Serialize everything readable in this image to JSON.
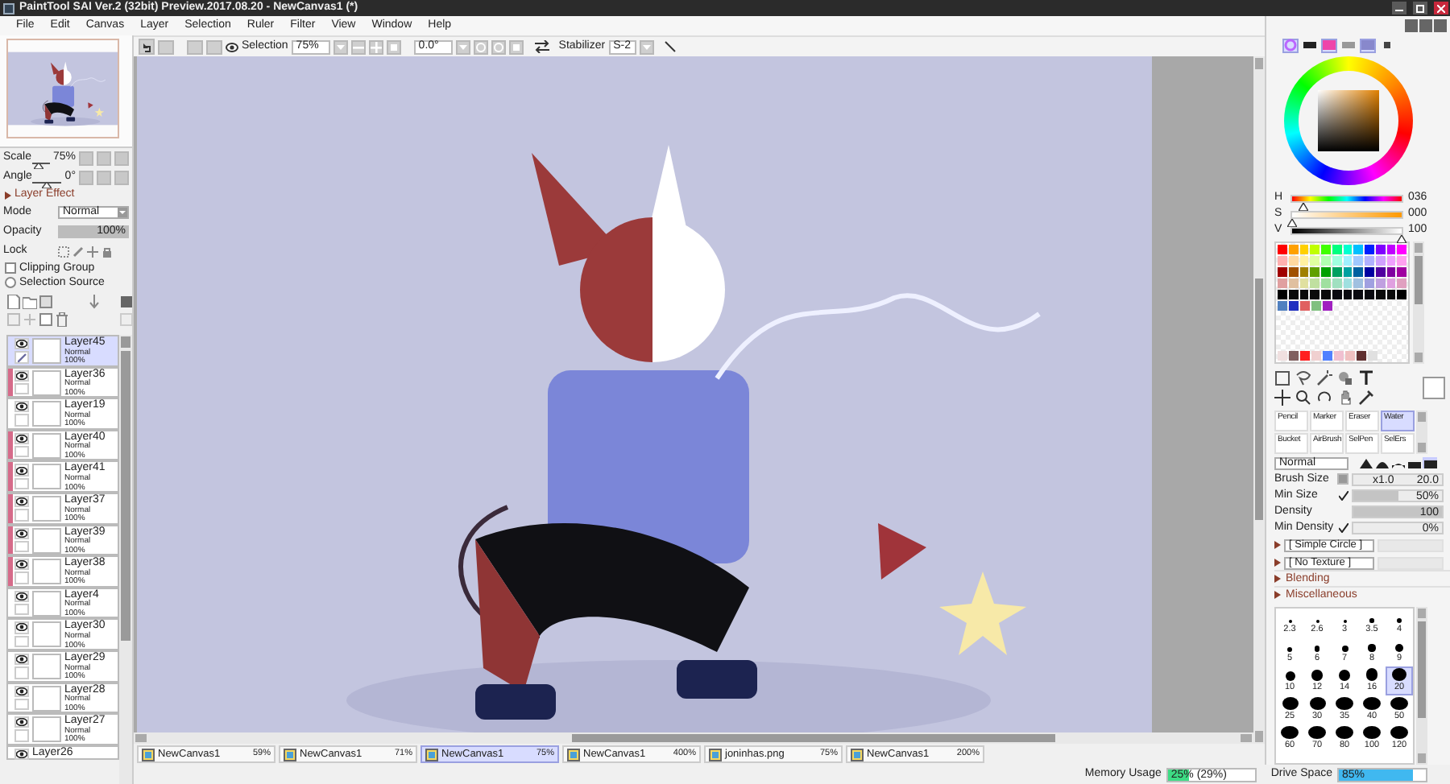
{
  "window": {
    "title": "PaintTool SAI Ver.2 (32bit) Preview.2017.08.20 - NewCanvas1 (*)"
  },
  "menu": [
    "File",
    "Edit",
    "Canvas",
    "Layer",
    "Selection",
    "Ruler",
    "Filter",
    "View",
    "Window",
    "Help"
  ],
  "toolbar": {
    "selection_label": "Selection",
    "zoom": "75%",
    "angle": "0.0°",
    "stabilizer_label": "Stabilizer",
    "stabilizer": "S-2"
  },
  "navigator": {
    "scale_label": "Scale",
    "scale": "75%",
    "scale_level": {
      "level": 0.35
    },
    "angle_label": "Angle",
    "angle": "0°",
    "angle_level": {
      "level": 0.5
    }
  },
  "layer_effect": {
    "label": "Layer Effect",
    "expanded": false
  },
  "layer_props": {
    "mode_label": "Mode",
    "mode": "Normal",
    "opacity": {
      "label": "Opacity",
      "reading": "100%",
      "level": 1
    },
    "lock_label": "Lock",
    "clipping_group": {
      "label": "Clipping Group",
      "checked": false
    },
    "selection_source": {
      "label": "Selection Source",
      "checked": false
    }
  },
  "layers": [
    {
      "name": "Layer45",
      "mode": "Normal",
      "opacity": "100%",
      "selected": true,
      "clipped": false,
      "visible": true
    },
    {
      "name": "Layer36",
      "mode": "Normal",
      "opacity": "100%",
      "selected": false,
      "clipped": true,
      "visible": true
    },
    {
      "name": "Layer19",
      "mode": "Normal",
      "opacity": "100%",
      "selected": false,
      "clipped": false,
      "visible": true
    },
    {
      "name": "Layer40",
      "mode": "Normal",
      "opacity": "100%",
      "selected": false,
      "clipped": true,
      "visible": true
    },
    {
      "name": "Layer41",
      "mode": "Normal",
      "opacity": "100%",
      "selected": false,
      "clipped": true,
      "visible": true
    },
    {
      "name": "Layer37",
      "mode": "Normal",
      "opacity": "100%",
      "selected": false,
      "clipped": true,
      "visible": true
    },
    {
      "name": "Layer39",
      "mode": "Normal",
      "opacity": "100%",
      "selected": false,
      "clipped": true,
      "visible": true
    },
    {
      "name": "Layer38",
      "mode": "Normal",
      "opacity": "100%",
      "selected": false,
      "clipped": true,
      "visible": true
    },
    {
      "name": "Layer4",
      "mode": "Normal",
      "opacity": "100%",
      "selected": false,
      "clipped": false,
      "visible": true
    },
    {
      "name": "Layer30",
      "mode": "Normal",
      "opacity": "100%",
      "selected": false,
      "clipped": false,
      "visible": true
    },
    {
      "name": "Layer29",
      "mode": "Normal",
      "opacity": "100%",
      "selected": false,
      "clipped": false,
      "visible": true
    },
    {
      "name": "Layer28",
      "mode": "Normal",
      "opacity": "100%",
      "selected": false,
      "clipped": false,
      "visible": true
    },
    {
      "name": "Layer27",
      "mode": "Normal",
      "opacity": "100%",
      "selected": false,
      "clipped": false,
      "visible": true
    },
    {
      "name": "Layer26",
      "selected": false,
      "clipped": false,
      "visible": true
    }
  ],
  "color": {
    "panels": [
      {
        "on": true
      },
      {
        "on": false
      },
      {
        "on": true
      },
      {
        "on": false
      },
      {
        "on": true
      },
      {
        "on": false
      }
    ],
    "h": {
      "label": "H",
      "reading": "036",
      "level": 0.1
    },
    "s": {
      "label": "S",
      "reading": "000",
      "level": 0
    },
    "v": {
      "label": "V",
      "reading": "100",
      "level": 1
    }
  },
  "swatch_rows": [
    [
      {
        "color": "#ff0000"
      },
      {
        "color": "#ffa000"
      },
      {
        "color": "#ffd000"
      },
      {
        "color": "#c0ff00"
      },
      {
        "color": "#40ff00"
      },
      {
        "color": "#00ff80"
      },
      {
        "color": "#00ffd0"
      },
      {
        "color": "#00c0ff"
      },
      {
        "color": "#0020ff"
      },
      {
        "color": "#8000ff"
      },
      {
        "color": "#c000ff"
      },
      {
        "color": "#ff00ff"
      }
    ],
    [
      {
        "color": "#ffb0b0"
      },
      {
        "color": "#ffd8a0"
      },
      {
        "color": "#fff0a0"
      },
      {
        "color": "#e0ffa0"
      },
      {
        "color": "#b0ffb0"
      },
      {
        "color": "#a0ffe0"
      },
      {
        "color": "#a0f0ff"
      },
      {
        "color": "#a0c8ff"
      },
      {
        "color": "#b0b0ff"
      },
      {
        "color": "#d0a0ff"
      },
      {
        "color": "#f0a0ff"
      },
      {
        "color": "#ffa0f0"
      }
    ],
    [
      {
        "color": "#a00000"
      },
      {
        "color": "#a05000"
      },
      {
        "color": "#a08000"
      },
      {
        "color": "#60a000"
      },
      {
        "color": "#00a000"
      },
      {
        "color": "#00a060"
      },
      {
        "color": "#00a0a0"
      },
      {
        "color": "#0060a0"
      },
      {
        "color": "#0000a0"
      },
      {
        "color": "#5000a0"
      },
      {
        "color": "#8000a0"
      },
      {
        "color": "#a000a0"
      }
    ],
    [
      {
        "color": "#e0a0a0"
      },
      {
        "color": "#e0c0a0"
      },
      {
        "color": "#e0e0a0"
      },
      {
        "color": "#c0e0a0"
      },
      {
        "color": "#a0e0a0"
      },
      {
        "color": "#a0e0c0"
      },
      {
        "color": "#a0e0e0"
      },
      {
        "color": "#a0c0e0"
      },
      {
        "color": "#a0a0e0"
      },
      {
        "color": "#c0a0e0"
      },
      {
        "color": "#e0a0e0"
      },
      {
        "color": "#e0a0c0"
      }
    ],
    [
      {
        "color": "#000000"
      },
      {
        "color": "#0a0a0a"
      },
      {
        "color": "#0a0a0a"
      },
      {
        "color": "#0a0a0a"
      },
      {
        "color": "#0a0a0a"
      },
      {
        "color": "#0a0a10"
      },
      {
        "color": "#0a0a10"
      },
      {
        "color": "#0a0a10"
      },
      {
        "color": "#0a0a10"
      },
      {
        "color": "#0a0a0a"
      },
      {
        "color": "#0a0a0a"
      },
      {
        "color": "#000000"
      }
    ],
    [
      {
        "color": "#5080c0"
      },
      {
        "color": "#2030c0"
      },
      {
        "color": "#e06060"
      },
      {
        "color": "#80c080"
      },
      {
        "color": "#a020c0"
      }
    ],
    [
      {
        "color": "#f0e0e0"
      },
      {
        "color": "#806060"
      },
      {
        "color": "#ff2020"
      },
      {
        "color": "#f0d0d0"
      },
      {
        "color": "#5080ff"
      },
      {
        "color": "#f0c0d0"
      },
      {
        "color": "#f0c0c0"
      },
      {
        "color": "#603030"
      },
      {
        "color": "#e0e0e0"
      }
    ]
  ],
  "current_color": {
    "color": "#ffffff"
  },
  "brushes": [
    {
      "name": "Pencil",
      "selected": false
    },
    {
      "name": "Marker",
      "selected": false
    },
    {
      "name": "Eraser",
      "selected": false
    },
    {
      "name": "Water",
      "selected": true
    },
    {
      "name": "Bucket",
      "selected": false
    },
    {
      "name": "AirBrush",
      "selected": false
    },
    {
      "name": "SelPen",
      "selected": false
    },
    {
      "name": "SelErs",
      "selected": false
    }
  ],
  "brush_mode": "Normal",
  "brush_shapes": [
    {
      "selected": false
    },
    {
      "selected": false
    },
    {
      "selected": false
    },
    {
      "selected": false
    },
    {
      "selected": true
    }
  ],
  "brush_size": {
    "label": "Brush Size",
    "multiplier": "x1.0",
    "reading": "20.0"
  },
  "min_size": {
    "label": "Min Size",
    "checked": true,
    "level": 0.5,
    "reading": "50%"
  },
  "density": {
    "label": "Density",
    "level": 1,
    "reading": "100"
  },
  "min_density": {
    "label": "Min Density",
    "checked": true,
    "level": 0,
    "reading": "0%"
  },
  "shape": {
    "label": "[ Simple Circle ]",
    "disabled": true
  },
  "texture": {
    "label": "[ No Texture ]",
    "disabled": true
  },
  "sections": [
    {
      "label": "Blending",
      "expanded": false
    },
    {
      "label": "Miscellaneous",
      "expanded": false
    }
  ],
  "brush_sizes": [
    {
      "label": "2.3",
      "selected": false
    },
    {
      "label": "2.6",
      "selected": false
    },
    {
      "label": "3",
      "selected": false
    },
    {
      "label": "3.5",
      "selected": false
    },
    {
      "label": "4",
      "selected": false
    },
    {
      "label": "5",
      "selected": false
    },
    {
      "label": "6",
      "selected": false
    },
    {
      "label": "7",
      "selected": false
    },
    {
      "label": "8",
      "selected": false
    },
    {
      "label": "9",
      "selected": false
    },
    {
      "label": "10",
      "selected": false
    },
    {
      "label": "12",
      "selected": false
    },
    {
      "label": "14",
      "selected": false
    },
    {
      "label": "16",
      "selected": false
    },
    {
      "label": "20",
      "selected": true
    },
    {
      "label": "25",
      "selected": false
    },
    {
      "label": "30",
      "selected": false
    },
    {
      "label": "35",
      "selected": false
    },
    {
      "label": "40",
      "selected": false
    },
    {
      "label": "50",
      "selected": false
    },
    {
      "label": "60",
      "selected": false
    },
    {
      "label": "70",
      "selected": false
    },
    {
      "label": "80",
      "selected": false
    },
    {
      "label": "100",
      "selected": false
    },
    {
      "label": "120",
      "selected": false
    }
  ],
  "canvas_tabs": [
    {
      "name": "NewCanvas1",
      "zoom": "59%",
      "selected": false
    },
    {
      "name": "NewCanvas1",
      "zoom": "71%",
      "selected": false
    },
    {
      "name": "NewCanvas1",
      "zoom": "75%",
      "selected": true
    },
    {
      "name": "NewCanvas1",
      "zoom": "400%",
      "selected": false
    },
    {
      "name": "joninhas.png",
      "zoom": "75%",
      "selected": false
    },
    {
      "name": "NewCanvas1",
      "zoom": "200%",
      "selected": false
    }
  ],
  "status": {
    "memory": {
      "label": "Memory Usage",
      "reading": "25% (29%)",
      "level": 0.25
    },
    "drive": {
      "label": "Drive Space",
      "reading": "85%",
      "level": 0.85
    }
  }
}
